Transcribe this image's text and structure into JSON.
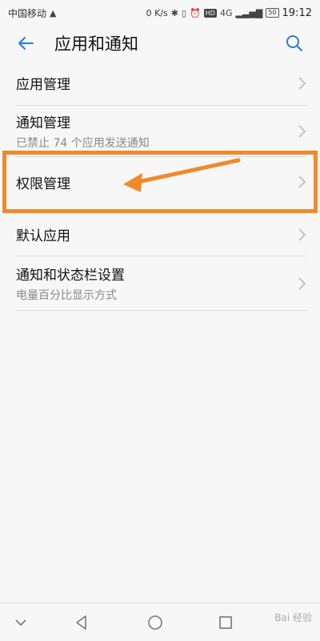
{
  "status_bar": {
    "carrier": "中国移动",
    "speed": "0 K/s",
    "network": "4G",
    "battery": "50",
    "time": "19:12"
  },
  "header": {
    "title": "应用和通知",
    "back_icon": "back-arrow-icon",
    "search_icon": "search-icon",
    "accent_color": "#2a7bd4"
  },
  "list": {
    "items": [
      {
        "title": "应用管理",
        "subtitle": ""
      },
      {
        "title": "通知管理",
        "subtitle": "已禁止 74 个应用发送通知"
      },
      {
        "title": "权限管理",
        "subtitle": ""
      },
      {
        "title": "默认应用",
        "subtitle": ""
      },
      {
        "title": "通知和状态栏设置",
        "subtitle": "电量百分比显示方式"
      }
    ]
  },
  "annotation": {
    "highlight_color": "#f08a2c",
    "highlighted_item": "权限管理"
  },
  "nav_bar": {
    "buttons": [
      "collapse-icon",
      "back-icon",
      "home-icon",
      "recents-icon"
    ]
  },
  "watermark": {
    "text": "Bai 经验"
  }
}
